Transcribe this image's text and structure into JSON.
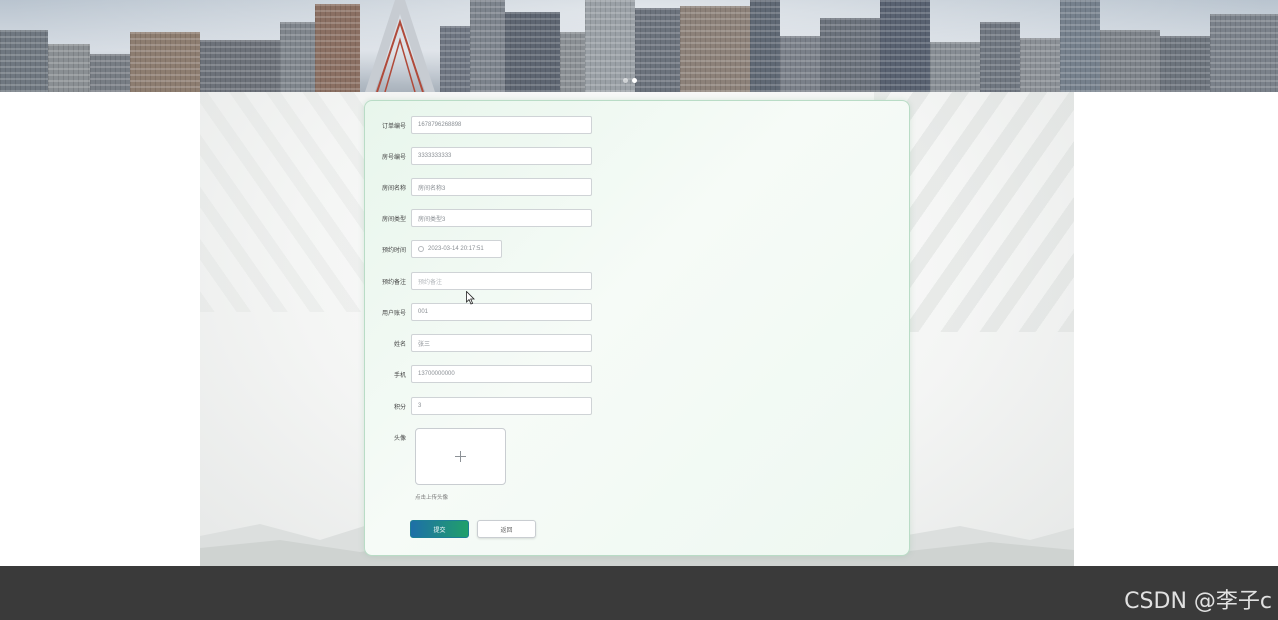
{
  "form": {
    "fields": [
      {
        "label": "订单编号",
        "value": "1678796268898",
        "placeholder": ""
      },
      {
        "label": "房号编号",
        "value": "3333333333",
        "placeholder": ""
      },
      {
        "label": "房间名称",
        "value": "房间名称3",
        "placeholder": ""
      },
      {
        "label": "房间类型",
        "value": "房间类型3",
        "placeholder": ""
      },
      {
        "label": "预约时间",
        "value": "2023-03-14 20:17:51",
        "placeholder": ""
      },
      {
        "label": "预约备注",
        "value": "",
        "placeholder": "预约备注"
      },
      {
        "label": "用户账号",
        "value": "001",
        "placeholder": ""
      },
      {
        "label": "姓名",
        "value": "张三",
        "placeholder": ""
      },
      {
        "label": "手机",
        "value": "13700000000",
        "placeholder": ""
      },
      {
        "label": "积分",
        "value": "3",
        "placeholder": ""
      }
    ],
    "avatar_label": "头像",
    "upload_hint": "点击上传头像",
    "submit_label": "提交",
    "back_label": "返回"
  },
  "carousel": {
    "active_index": 1,
    "count": 2
  },
  "watermark": "CSDN @李子c",
  "colors": {
    "card_border": "#b9dcc6",
    "submit_start": "#1e6fa8",
    "submit_end": "#20a06a",
    "footer": "#3a3a3a"
  }
}
